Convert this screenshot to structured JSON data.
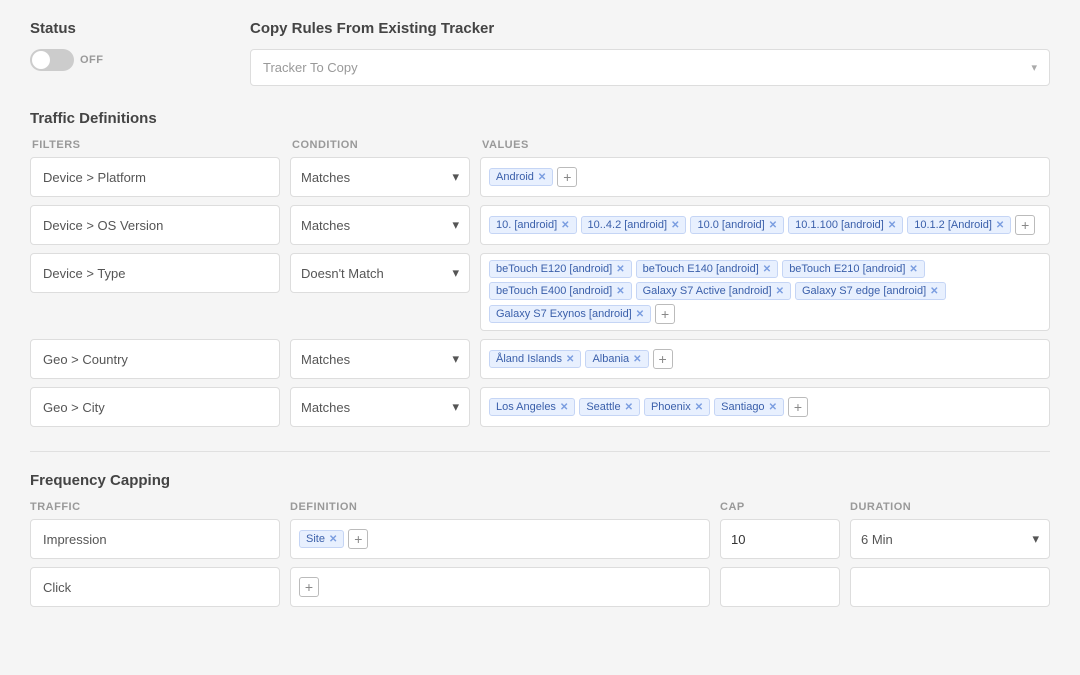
{
  "status": {
    "title": "Status",
    "toggle_state": "OFF",
    "toggle_label": "OFF"
  },
  "copy_rules": {
    "title": "Copy Rules From Existing Tracker",
    "placeholder": "Tracker To Copy",
    "chevron": "▾"
  },
  "traffic_definitions": {
    "title": "Traffic Definitions",
    "col_filters": "FILTERS",
    "col_condition": "CONDITION",
    "col_values": "VALUES",
    "rows": [
      {
        "filter": "Device > Platform",
        "condition": "Matches",
        "tags": [
          "Android"
        ],
        "has_add": true
      },
      {
        "filter": "Device > OS Version",
        "condition": "Matches",
        "tags": [
          "10. [android]",
          "10..4.2 [android]",
          "10.0 [android]",
          "10.1.100 [android]",
          "10.1.2 [Android]"
        ],
        "has_add": true
      },
      {
        "filter": "Device > Type",
        "condition": "Doesn't Match",
        "tags": [
          "beTouch E120 [android]",
          "beTouch E140 [android]",
          "beTouch E210 [android]",
          "beTouch E400 [android]",
          "Galaxy S7 Active [android]",
          "Galaxy S7 edge [android]",
          "Galaxy S7 Exynos [android]"
        ],
        "has_add": true
      },
      {
        "filter": "Geo > Country",
        "condition": "Matches",
        "tags": [
          "Åland Islands",
          "Albania"
        ],
        "has_add": true
      },
      {
        "filter": "Geo > City",
        "condition": "Matches",
        "tags": [
          "Los Angeles",
          "Seattle",
          "Phoenix",
          "Santiago"
        ],
        "has_add": true
      }
    ]
  },
  "frequency_capping": {
    "title": "Frequency Capping",
    "col_traffic": "TRAFFIC",
    "col_definition": "DEFINITION",
    "col_cap": "CAP",
    "col_duration": "DURATION",
    "rows": [
      {
        "traffic": "Impression",
        "definition_tags": [
          "Site"
        ],
        "has_add": true,
        "cap_value": "10",
        "duration": "6 Min",
        "has_chevron": true
      },
      {
        "traffic": "Click",
        "definition_tags": [],
        "has_add": true,
        "cap_value": "",
        "duration": "",
        "has_chevron": false
      }
    ]
  }
}
